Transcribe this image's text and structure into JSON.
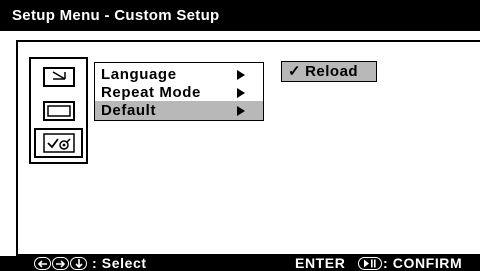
{
  "title_bar": {
    "text": "Setup Menu - Custom Setup"
  },
  "category_icons": [
    {
      "icon": "screen-setup-icon"
    },
    {
      "icon": "display-icon"
    },
    {
      "icon": "custom-setup-icon",
      "selected": true
    }
  ],
  "submenu": {
    "items": [
      {
        "label": "Language",
        "highlighted": false
      },
      {
        "label": "Repeat Mode",
        "highlighted": false
      },
      {
        "label": "Default",
        "highlighted": true
      }
    ]
  },
  "option": {
    "check": "✓",
    "label": "Reload"
  },
  "footer": {
    "nav_icons": [
      "left-arrow-icon",
      "right-arrow-icon",
      "down-arrow-icon"
    ],
    "select_label": ": Select",
    "enter_label": "ENTER",
    "confirm_label": ": CONFIRM"
  },
  "colors": {
    "title_bg": "#000000",
    "highlight": "#b8b8b8",
    "footer_bg": "#000000"
  }
}
